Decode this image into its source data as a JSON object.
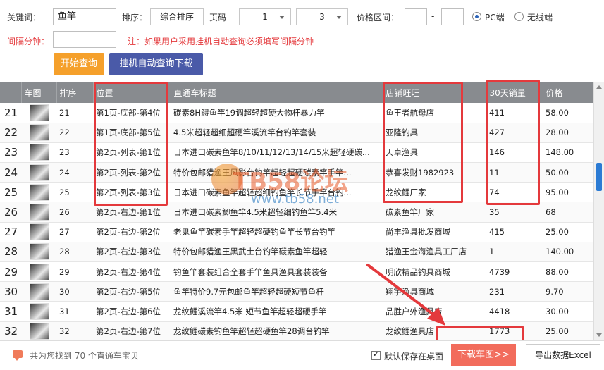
{
  "form": {
    "keyword_label": "关键词：",
    "keyword_value": "鱼竿",
    "sort_label": "排序：",
    "sort_value": "综合排序",
    "page_label": "页码",
    "page_from": "1",
    "page_to": "3",
    "price_label": "价格区间：",
    "price_min": "",
    "price_dash": "-",
    "price_max": "",
    "radio_pc": "PC端",
    "radio_wireless": "无线端",
    "radio_selected": "PC端",
    "interval_label": "间隔分钟：",
    "interval_value": "",
    "notice": "注：如果用户采用挂机自动查询必须填写间隔分钟",
    "btn_query": "开始查询",
    "btn_auto": "挂机自动查询下载"
  },
  "table": {
    "headers": [
      "",
      "车图",
      "排序",
      "位置",
      "直通车标题",
      "店铺旺旺",
      "30天销量",
      "价格"
    ],
    "rows": [
      {
        "idx": "21",
        "rank": "21",
        "pos": "第1页-底部-第4位",
        "title": "碳素8H鲟鱼竿19调超轻超硬大物杆暴力竿",
        "shop": "鱼王者航母店",
        "sales": "411",
        "price": "58.00"
      },
      {
        "idx": "22",
        "rank": "22",
        "pos": "第1页-底部-第5位",
        "title": "4.5米超轻超细超硬竿溪流竿台钓竿套装",
        "shop": "亚隆钓具",
        "sales": "427",
        "price": "28.00"
      },
      {
        "idx": "23",
        "rank": "23",
        "pos": "第2页-列表-第1位",
        "title": "日本进口碳素鱼竿8/10/11/12/13/14/15米超轻硬碳...",
        "shop": "天卓渔具",
        "sales": "146",
        "price": "148.00"
      },
      {
        "idx": "24",
        "rank": "24",
        "pos": "第2页-列表-第2位",
        "title": "特价包邮猎渔王风影台钓竿超轻超硬碳素竿手竿...",
        "shop": "恭喜发财1982923",
        "sales": "11",
        "price": "50.00"
      },
      {
        "idx": "25",
        "rank": "25",
        "pos": "第2页-列表-第3位",
        "title": "日本进口碳素鱼竿超轻超细钓鱼竿长节手竿台钓...",
        "shop": "龙纹鲤厂家",
        "sales": "74",
        "price": "95.00"
      },
      {
        "idx": "26",
        "rank": "26",
        "pos": "第2页-右边-第1位",
        "title": "日本进口碳素鲫鱼竿4.5米超轻细钓鱼竿5.4米",
        "shop": "碳素鱼竿厂家",
        "sales": "35",
        "price": "68"
      },
      {
        "idx": "27",
        "rank": "27",
        "pos": "第2页-右边-第2位",
        "title": "老鬼鱼竿碳素手竿超轻超硬钓鱼竿长节台钓竿",
        "shop": "尚丰渔具批发商城",
        "sales": "415",
        "price": "25.00"
      },
      {
        "idx": "28",
        "rank": "28",
        "pos": "第2页-右边-第3位",
        "title": "特价包邮猎渔王黑武士台钓竿碳素鱼竿超轻",
        "shop": "猎渔王金海渔具工厂店",
        "sales": "1",
        "price": "140.00"
      },
      {
        "idx": "29",
        "rank": "29",
        "pos": "第2页-右边-第4位",
        "title": "钓鱼竿套装组合全套手竿鱼具渔具套装装备",
        "shop": "明欣精品钓具商城",
        "sales": "4739",
        "price": "88.00"
      },
      {
        "idx": "30",
        "rank": "30",
        "pos": "第2页-右边-第5位",
        "title": "鱼竿特价9.7元包邮鱼竿超轻超硬短节鱼杆",
        "shop": "翔宇渔具商城",
        "sales": "231",
        "price": "9.70"
      },
      {
        "idx": "31",
        "rank": "31",
        "pos": "第2页-右边-第6位",
        "title": "龙纹鲤溪流竿4.5米 短节鱼竿超轻超硬手竿",
        "shop": "品胜户外渔具店",
        "sales": "4418",
        "price": "30.00"
      },
      {
        "idx": "32",
        "rank": "32",
        "pos": "第2页-右边-第7位",
        "title": "龙纹鲤碳素钓鱼竿超轻超硬鱼竿28调台钓竿",
        "shop": "龙纹鲤渔具店",
        "sales": "1773",
        "price": "25.00"
      }
    ]
  },
  "watermark": {
    "brand": "TB58论坛",
    "url": "www.tb58.net"
  },
  "footer": {
    "count_text": "共为您找到 70 个直通车宝贝",
    "checkbox_label": "默认保存在桌面",
    "checkbox_checked": true,
    "download_btn": "下载车图>>",
    "export_btn": "导出数据Excel"
  },
  "colors": {
    "highlight_red": "#e4393c",
    "header_gray": "#888b8f",
    "btn_orange": "#f5a02b",
    "btn_navy": "#4a5aa8",
    "download_red": "#f26c5c"
  }
}
